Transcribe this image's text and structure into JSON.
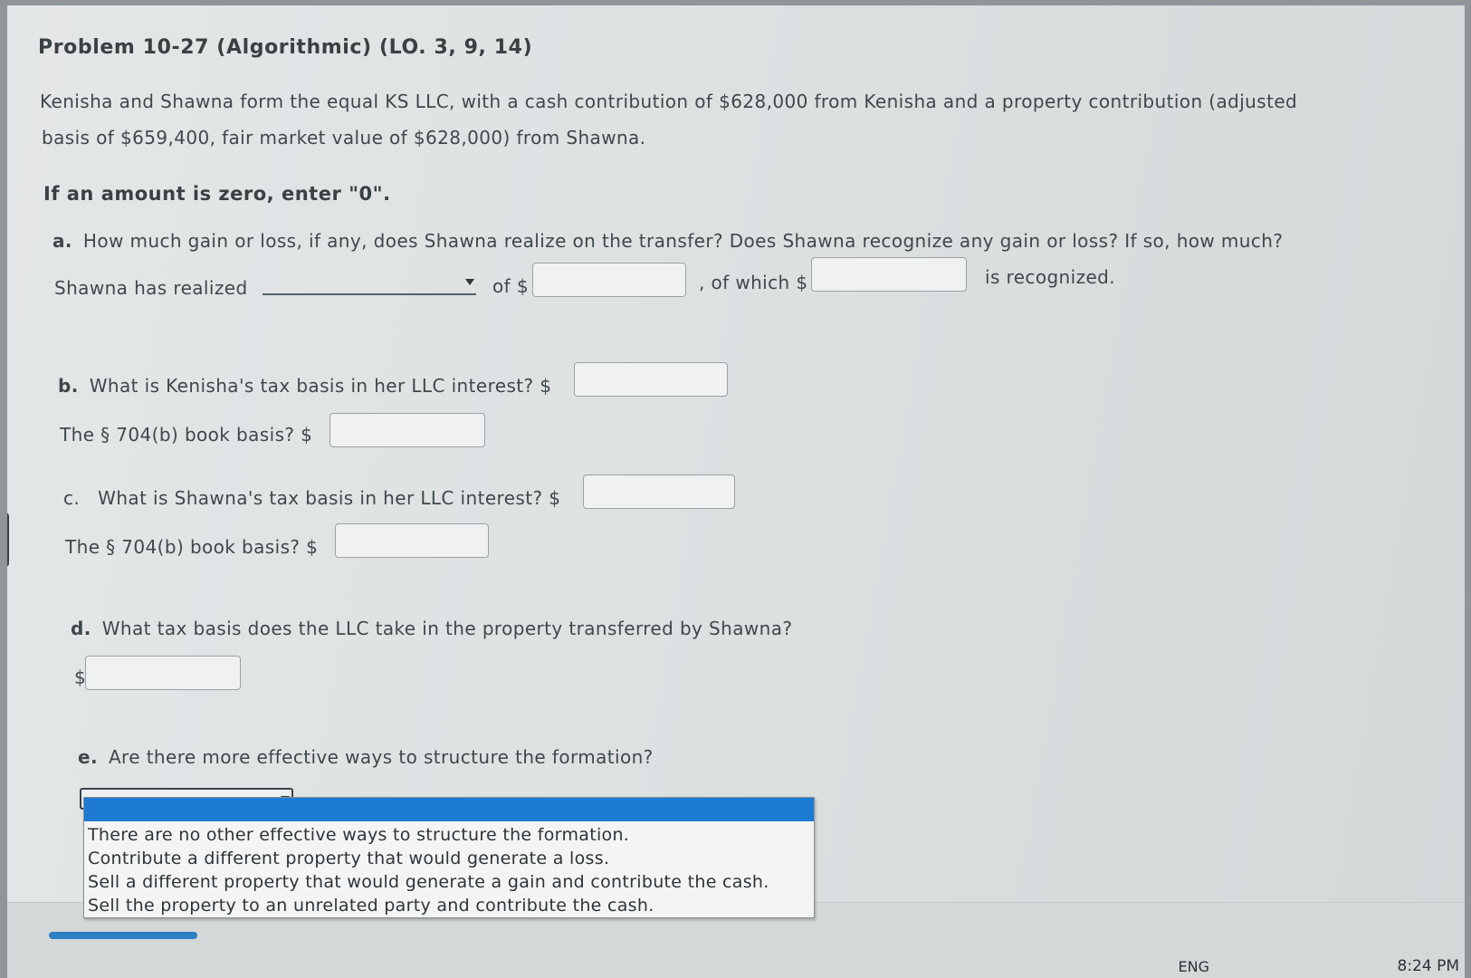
{
  "problem": {
    "title": "Problem 10-27 (Algorithmic) (LO. 3, 9, 14)",
    "intro_line1": "Kenisha and Shawna form the equal KS LLC, with a cash contribution of $628,000 from Kenisha and a property contribution (adjusted",
    "intro_line2": "basis of $659,400, fair market value of $628,000) from Shawna.",
    "zero_note": "If an amount is zero, enter \"0\"."
  },
  "part_a": {
    "letter": "a.",
    "question": "How much gain or loss, if any, does Shawna realize on the transfer? Does Shawna recognize any gain or loss? If so, how much?",
    "prefix": "Shawna has realized",
    "select_value": "",
    "of_label": "of $",
    "of_which_label": ", of which $",
    "suffix": "is recognized.",
    "amount_value": "",
    "recognized_value": ""
  },
  "part_b": {
    "letter": "b.",
    "question": "What is Kenisha's tax basis in her LLC interest? $",
    "book_label": "The § 704(b) book basis? $",
    "tax_value": "",
    "book_value": ""
  },
  "part_c": {
    "letter": "c.",
    "question": "What is Shawna's tax basis in her LLC interest? $",
    "book_label": "The § 704(b) book basis? $",
    "tax_value": "",
    "book_value": ""
  },
  "part_d": {
    "letter": "d.",
    "question": "What tax basis does the LLC take in the property transferred by Shawna?",
    "dollar": "$",
    "value": ""
  },
  "part_e": {
    "letter": "e.",
    "question": "Are there more effective ways to structure the formation?",
    "options": [
      "There are no other effective ways to structure the formation.",
      "Contribute a different property that would generate a loss.",
      "Sell a different property that would generate a gain and contribute the cash.",
      "Sell the property to an unrelated party and contribute the cash."
    ]
  },
  "taskbar": {
    "lang": "ENG",
    "time": "8:24 PM"
  },
  "colors": {
    "highlight": "#1e7bd4",
    "page_bg": "#e0e3e4"
  }
}
